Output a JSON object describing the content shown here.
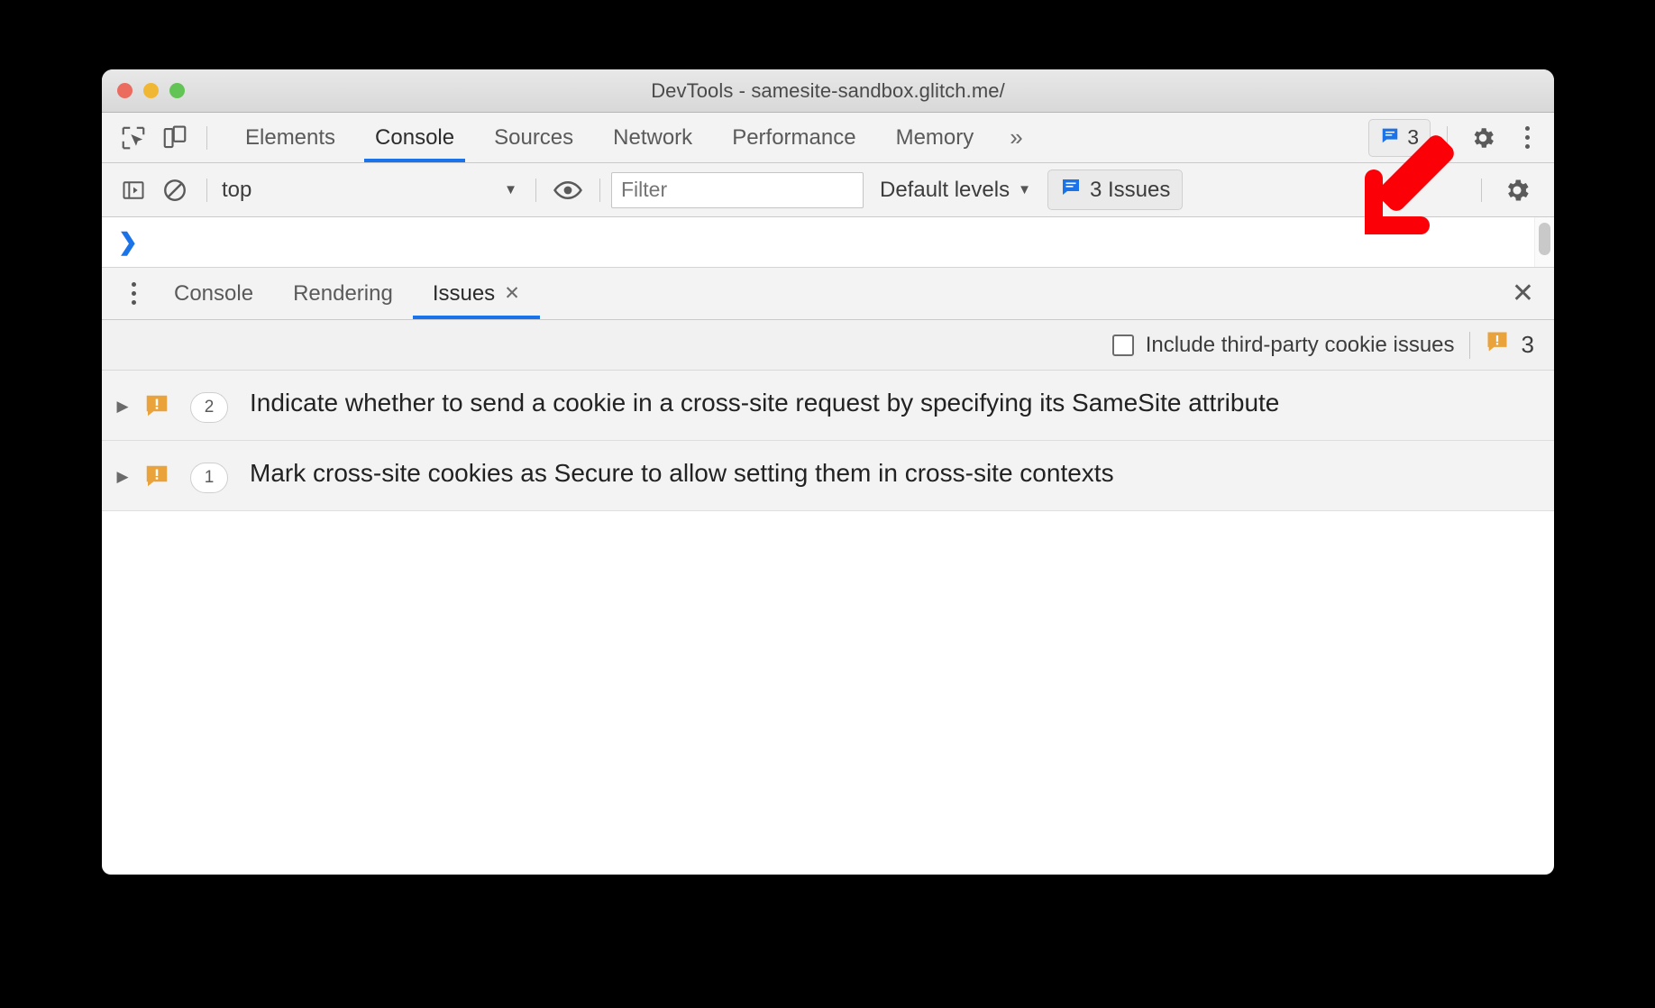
{
  "window": {
    "title": "DevTools - samesite-sandbox.glitch.me/",
    "traffic_lights": [
      "close-red",
      "minimize-yellow",
      "zoom-green"
    ]
  },
  "main_tabs": {
    "inspect_icon": "inspect-element-icon",
    "device_icon": "toggle-device-toolbar-icon",
    "items": [
      {
        "label": "Elements",
        "active": false
      },
      {
        "label": "Console",
        "active": true
      },
      {
        "label": "Sources",
        "active": false
      },
      {
        "label": "Network",
        "active": false
      },
      {
        "label": "Performance",
        "active": false
      },
      {
        "label": "Memory",
        "active": false
      }
    ],
    "overflow_label": "»",
    "issues_chip": {
      "icon": "issue-message-icon",
      "label": "3"
    },
    "settings_icon": "gear-icon",
    "more_icon": "kebab-menu-icon"
  },
  "console_toolbar": {
    "sidebar_icon": "console-sidebar-icon",
    "clear_icon": "clear-console-icon",
    "context": "top",
    "context_caret": "▼",
    "eye_icon": "live-expression-icon",
    "filter_placeholder": "Filter",
    "filter_value": "",
    "levels_label": "Default levels",
    "levels_caret": "▼",
    "issues_button": {
      "icon": "issue-message-icon",
      "label": "3 Issues"
    },
    "settings_icon": "gear-icon"
  },
  "console_prompt": {
    "caret": "❯"
  },
  "drawer": {
    "menu_icon": "kebab-menu-icon",
    "tabs": [
      {
        "label": "Console",
        "active": false,
        "closable": false
      },
      {
        "label": "Rendering",
        "active": false,
        "closable": false
      },
      {
        "label": "Issues",
        "active": true,
        "closable": true,
        "close_glyph": "✕"
      }
    ],
    "close_glyph": "✕"
  },
  "issues_panel": {
    "third_party_checkbox": {
      "label": "Include third-party cookie issues",
      "checked": false
    },
    "warning_icon": "warning-bubble-icon",
    "warning_count": "3",
    "rows": [
      {
        "expand_glyph": "▶",
        "icon": "warning-bubble-icon",
        "count": "2",
        "text": "Indicate whether to send a cookie in a cross-site request by specifying its SameSite attribute"
      },
      {
        "expand_glyph": "▶",
        "icon": "warning-bubble-icon",
        "count": "1",
        "text": "Mark cross-site cookies as Secure to allow setting them in cross-site contexts"
      }
    ]
  },
  "annotation": {
    "arrow": "red-arrow-pointing-down-left",
    "color": "#fb0007"
  },
  "colors": {
    "accent_blue": "#1a73e8",
    "warning_orange": "#e9a33a",
    "toolbar_bg": "#f3f3f3",
    "row_bg": "#f3f3f3",
    "annotation_red": "#fb0007"
  }
}
